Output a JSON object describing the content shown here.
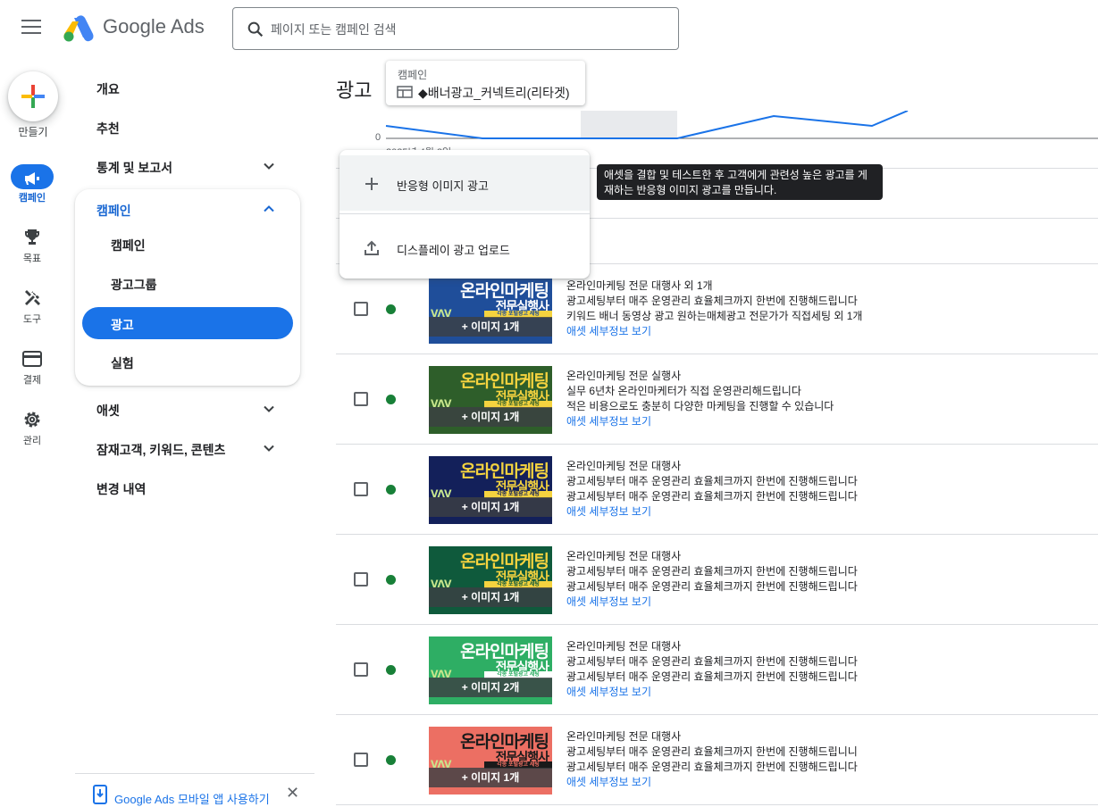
{
  "header": {
    "brand": "Google Ads",
    "search_placeholder": "페이지 또는 캠페인 검색"
  },
  "rail": {
    "create_label": "만들기",
    "items": [
      {
        "label": "캠페인",
        "icon": "megaphone-icon",
        "active": true
      },
      {
        "label": "목표",
        "icon": "trophy-icon"
      },
      {
        "label": "도구",
        "icon": "tools-icon"
      },
      {
        "label": "결제",
        "icon": "credit-card-icon"
      },
      {
        "label": "관리",
        "icon": "gear-icon"
      }
    ]
  },
  "nav": {
    "overview": "개요",
    "recommendations": "추천",
    "stats_reports": "통계 및 보고서",
    "campaigns_group": "캠페인",
    "sub": [
      "캠페인",
      "광고그룹",
      "광고",
      "실험"
    ],
    "assets": "애셋",
    "audiences": "잠재고객, 키워드, 콘텐츠",
    "change_history": "변경 내역",
    "mobile_app": "Google Ads 모바일 앱 사용하기",
    "close": "✕"
  },
  "main": {
    "title": "광고",
    "campaign_kind": "캠페인",
    "campaign_name": "◆배너광고_커넥트리(리타겟)",
    "chart_zero": "0",
    "chart_date": "2025년 4월 3일"
  },
  "menu": {
    "items": [
      {
        "label": "반응형 이미지 광고",
        "icon": "plus-icon"
      },
      {
        "label": "디스플레이 광고 업로드",
        "icon": "upload-icon"
      }
    ]
  },
  "tooltip": "애셋을 결합 및 테스트한 후 고객에게 관련성 높은 광고를 게재하는 반응형 이미지 광고를 만듭니다.",
  "colors": {
    "accent": "#1a73e8",
    "status_enabled": "#188038"
  },
  "ads": [
    {
      "thumb_line1": "온라인마케팅",
      "thumb_line2": "전문실행사",
      "thumb_line3": "각종 포털광고 세팅",
      "thumb_bg": "#1f4e9a",
      "thumb_fg": "#ffffff",
      "images": "+ 이미지 1개",
      "lines": [
        "온라인마케팅 전문 대행사 외 1개",
        "광고세팅부터 매주 운영관리 효율체크까지 한번에 진행해드립니다",
        "키워드 배너 동영상 광고 원하는매체광고 전문가가 직접세팅 외 1개"
      ],
      "link": "애셋 세부정보 보기"
    },
    {
      "thumb_line1": "온라인마케팅",
      "thumb_line2": "전문실행사",
      "thumb_line3": "각종 포털광고 세팅",
      "thumb_bg": "#2e5e2a",
      "thumb_fg": "#f5d33f",
      "images": "+ 이미지 1개",
      "lines": [
        "온라인마케팅 전문 실행사",
        "실무 6년차 온라인마케터가 직접 운영관리해드립니다",
        "적은 비용으로도 충분히 다양한 마케팅을 진행할 수 있습니다"
      ],
      "link": "애셋 세부정보 보기"
    },
    {
      "thumb_line1": "온라인마케팅",
      "thumb_line2": "전문실행사",
      "thumb_line3": "각종 포털광고 세팅",
      "thumb_bg": "#13205a",
      "thumb_fg": "#f5d33f",
      "images": "+ 이미지 1개",
      "lines": [
        "온라인마케팅 전문 대행사",
        "광고세팅부터 매주 운영관리 효율체크까지 한번에 진행해드립니다",
        "광고세팅부터 매주 운영관리 효율체크까지 한번에 진행해드립니다"
      ],
      "link": "애셋 세부정보 보기"
    },
    {
      "thumb_line1": "온라인마케팅",
      "thumb_line2": "전문실행사",
      "thumb_line3": "각종 포털광고 세팅",
      "thumb_bg": "#0f5a3c",
      "thumb_fg": "#f5d33f",
      "images": "+ 이미지 1개",
      "lines": [
        "온라인마케팅 전문 대행사",
        "광고세팅부터 매주 운영관리 효율체크까지 한번에 진행해드립니다",
        "광고세팅부터 매주 운영관리 효율체크까지 한번에 진행해드립니다"
      ],
      "link": "애셋 세부정보 보기"
    },
    {
      "thumb_line1": "온라인마케팅",
      "thumb_line2": "전문실행사",
      "thumb_line3": "각종 포털광고 세팅",
      "thumb_bg": "#2eae64",
      "thumb_fg": "#ffffff",
      "images": "+ 이미지 2개",
      "lines": [
        "온라인마케팅 전문 대행사",
        "광고세팅부터 매주 운영관리 효율체크까지 한번에 진행해드립니다",
        "광고세팅부터 매주 운영관리 효율체크까지 한번에 진행해드립니다"
      ],
      "link": "애셋 세부정보 보기"
    },
    {
      "thumb_line1": "온라인마케팅",
      "thumb_line2": "전문실행사",
      "thumb_line3": "각종 포털광고 세팅",
      "thumb_bg": "#ec6f63",
      "thumb_fg": "#1a1a1a",
      "images": "+ 이미지 1개",
      "lines": [
        "온라인마케팅 전문 대행사",
        "광고세팅부터 매주 운영관리 효율체크까지 한번에 진행해드립니니",
        "광고세팅부터 매주 운영관리 효율체크까지 한번에 진행해드립니다"
      ],
      "link": "애셋 세부정보 보기"
    }
  ]
}
